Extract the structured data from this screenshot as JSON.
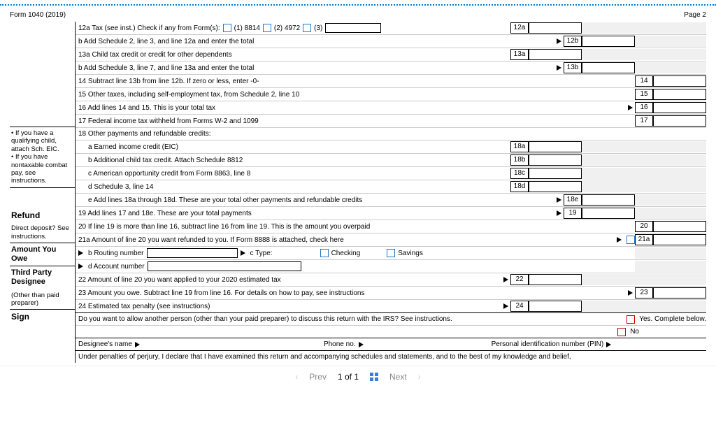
{
  "header": {
    "left": "Form 1040 (2019)",
    "right": "Page 2"
  },
  "sidebar": {
    "note1": "• If you have a qualifying child, attach Sch. EIC.\n• If you have nontaxable combat pay, see instructions.",
    "refund": "Refund",
    "deposit": "Direct deposit? See instructions.",
    "owe": "Amount You Owe",
    "third": "Third Party Designee",
    "other": "(Other than paid preparer)",
    "sign": "Sign"
  },
  "lines": {
    "l12a": "12a Tax (see inst.) Check if any from Form(s):",
    "l12a_opt1": "(1) 8814",
    "l12a_opt2": "(2) 4972",
    "l12a_opt3": "(3)",
    "n12a": "12a",
    "l12b": "b Add Schedule 2, line 3, and line 12a and enter the total",
    "n12b": "12b",
    "l13a": "13a Child tax credit or credit for other dependents",
    "n13a": "13a",
    "l13b": "b Add Schedule 3, line 7, and line 13a and enter the total",
    "n13b": "13b",
    "l14": "14 Subtract line 13b from line 12b. If zero or less, enter -0-",
    "n14": "14",
    "l15": "15 Other taxes, including self-employment tax, from Schedule 2, line 10",
    "n15": "15",
    "l16": "16 Add lines 14 and 15. This is your total tax",
    "n16": "16",
    "l17": "17 Federal income tax withheld from Forms W-2 and 1099",
    "n17": "17",
    "l18": "18 Other payments and refundable credits:",
    "l18a": "a Earned income credit (EIC)",
    "n18a": "18a",
    "l18b": "b Additional child tax credit. Attach Schedule 8812",
    "n18b": "18b",
    "l18c": "c American opportunity credit from Form 8863, line 8",
    "n18c": "18c",
    "l18d": "d Schedule 3, line 14",
    "n18d": "18d",
    "l18e": "e Add lines 18a through 18d. These are your total other payments and refundable credits",
    "n18e": "18e",
    "l19": "19 Add lines 17 and 18e. These are your total payments",
    "n19": "19",
    "l20": "20 If line 19 is more than line 16, subtract line 16 from line 19. This is the amount you overpaid",
    "n20": "20",
    "l21a": "21a Amount of line 20 you want refunded to you. If Form 8888 is attached, check here",
    "n21a": "21a",
    "l21b_label": "b  Routing number",
    "l21c_label": "c  Type:",
    "l21c_checking": "Checking",
    "l21c_savings": "Savings",
    "l21d_label": "d  Account number",
    "l22": "22 Amount of line 20 you want applied to your 2020 estimated tax",
    "n22": "22",
    "l23": "23  Amount you owe. Subtract line 19 from line 16. For details on how to pay, see instructions",
    "n23": "23",
    "l24": "24 Estimated tax penalty (see instructions)",
    "n24": "24",
    "third_q": "Do you want to allow another person (other than your paid preparer) to discuss this return with the IRS? See instructions.",
    "third_yes": "Yes. Complete below.",
    "third_no": "No",
    "des_name": "Designee's name",
    "des_phone": "Phone no.",
    "des_pin": "Personal identification number (PIN)",
    "sign_text": "Under penalties of perjury, I declare that I have examined this return and accompanying schedules and statements, and to the best of my knowledge and belief,"
  },
  "pager": {
    "prev": "Prev",
    "pos": "1 of 1",
    "next": "Next"
  }
}
